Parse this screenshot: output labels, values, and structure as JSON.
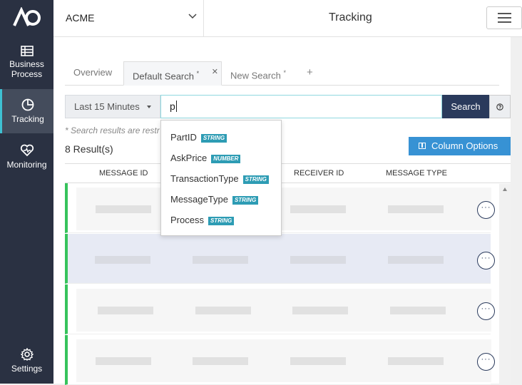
{
  "sidebar": {
    "items": [
      {
        "label_line1": "Business",
        "label_line2": "Process",
        "icon": "business-process-icon"
      },
      {
        "label": "Tracking",
        "icon": "tracking-icon",
        "active": true
      },
      {
        "label": "Monitoring",
        "icon": "monitoring-icon"
      },
      {
        "label": "Settings",
        "icon": "gear-icon"
      }
    ]
  },
  "topbar": {
    "org_name": "ACME",
    "title": "Tracking"
  },
  "tabs": [
    {
      "label": "Overview"
    },
    {
      "label": "Default Search",
      "modified": "*",
      "close": "✕"
    },
    {
      "label": "New Search",
      "modified": "*"
    }
  ],
  "add_tab": "+",
  "search": {
    "time_range": "Last 15 Minutes",
    "query": "p",
    "button": "Search",
    "help_icon": "question-circle-icon"
  },
  "note": "* Search results are restricted",
  "results_count": "8 Result(s)",
  "column_options": "Column Options",
  "table": {
    "columns": [
      "MESSAGE ID",
      "RECEIVER ID",
      "MESSAGE TYPE"
    ]
  },
  "suggestions": [
    {
      "field": "PartID",
      "type": "STRING"
    },
    {
      "field": "AskPrice",
      "type": "NUMBER"
    },
    {
      "field": "TransactionType",
      "type": "STRING"
    },
    {
      "field": "MessageType",
      "type": "STRING"
    },
    {
      "field": "Process",
      "type": "STRING"
    }
  ],
  "row_action": "···",
  "colors": {
    "sidebar_bg": "#2a3142",
    "accent_blue": "#3792d4",
    "search_btn": "#2a3a5c",
    "status_green": "#36c35c",
    "badge": "#2d9cb4"
  }
}
